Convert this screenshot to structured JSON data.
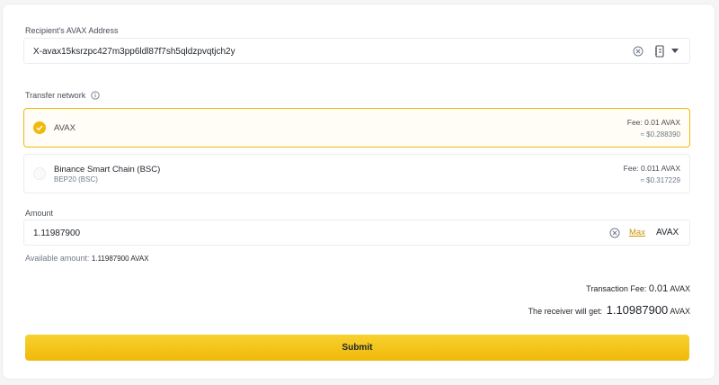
{
  "recipient": {
    "label": "Recipient's AVAX Address",
    "address": "X-avax15ksrzpc427m3pp6ldl87f7sh5qldzpvqtjch2y"
  },
  "network": {
    "label": "Transfer network",
    "options": [
      {
        "name": "AVAX",
        "sub": "",
        "fee": "Fee: 0.01 AVAX",
        "fee_usd": "≈ $0.288390",
        "selected": true
      },
      {
        "name": "Binance Smart Chain (BSC)",
        "sub": "BEP20 (BSC)",
        "fee": "Fee: 0.011 AVAX",
        "fee_usd": "≈ $0.317229",
        "selected": false
      }
    ]
  },
  "amount": {
    "label": "Amount",
    "value": "1.11987900",
    "max_label": "Max",
    "currency": "AVAX",
    "available_label": "Available amount:",
    "available_value": "1.11987900 AVAX"
  },
  "summary": {
    "fee_label": "Transaction Fee:",
    "fee_value": "0.01",
    "fee_currency": "AVAX",
    "receive_label": "The receiver will get:",
    "receive_value": "1.10987900",
    "receive_currency": "AVAX"
  },
  "submit_label": "Submit",
  "colors": {
    "accent": "#f0b90b",
    "text": "#1e2329",
    "muted": "#707a8a",
    "border": "#eaecef"
  },
  "icons": [
    "clear-icon",
    "address-book-icon",
    "caret-down-icon",
    "info-icon",
    "check-icon"
  ]
}
